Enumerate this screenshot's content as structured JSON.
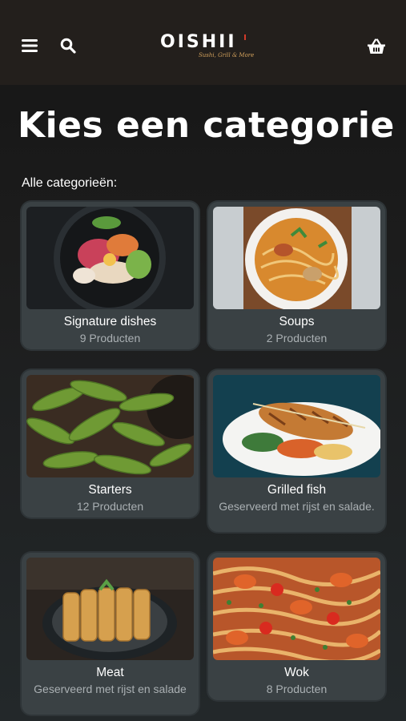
{
  "header": {
    "logo_text": "OISHII",
    "logo_tagline": "Sushi, Grill & More",
    "icons": [
      "menu-icon",
      "search-icon",
      "basket-icon"
    ]
  },
  "page": {
    "title": "Kies een categorie",
    "section_label": "Alle categorieën:"
  },
  "categories": [
    {
      "name": "Signature dishes",
      "subtitle": "9 Producten"
    },
    {
      "name": "Soups",
      "subtitle": "2 Producten"
    },
    {
      "name": "Starters",
      "subtitle": "12 Producten"
    },
    {
      "name": "Grilled fish",
      "subtitle": "Geserveerd met rijst en salade."
    },
    {
      "name": "Meat",
      "subtitle": "Geserveerd met rijst en salade"
    },
    {
      "name": "Wok",
      "subtitle": "8 Producten"
    }
  ],
  "colors": {
    "header_bg": "#231f1c",
    "card_bg": "#3a4144",
    "subtitle_text": "#aab0b3",
    "logo_accent": "#d2a15c"
  }
}
